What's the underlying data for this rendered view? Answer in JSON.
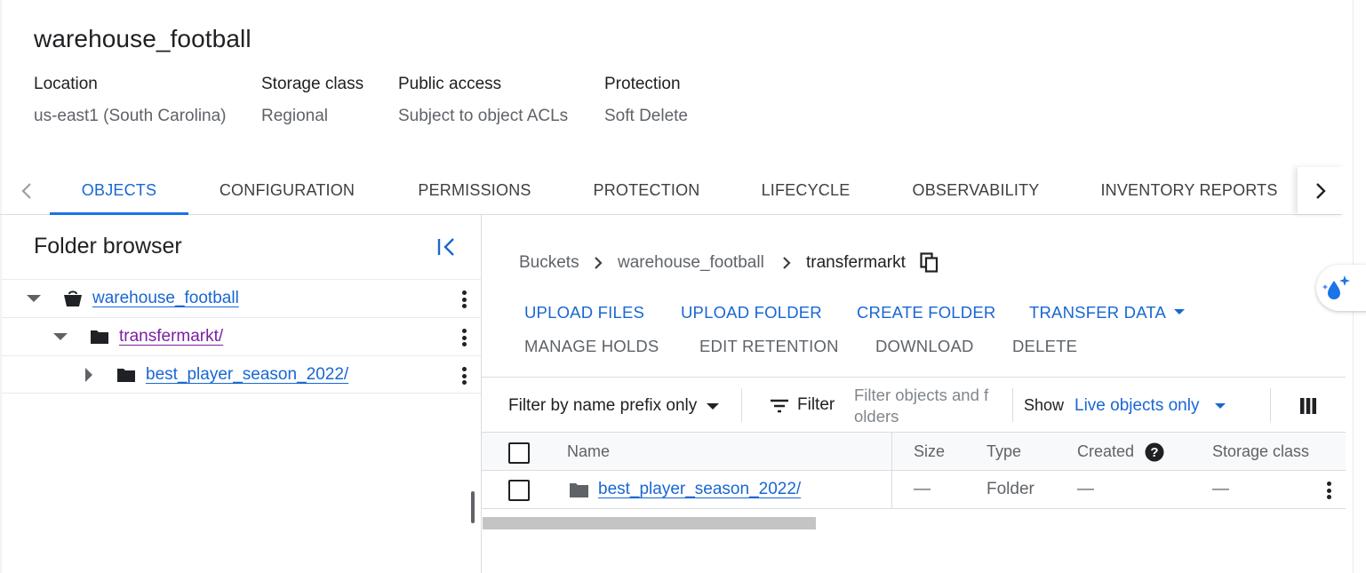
{
  "bucket": {
    "title": "warehouse_football",
    "meta": [
      {
        "label": "Location",
        "value": "us-east1 (South Carolina)"
      },
      {
        "label": "Storage class",
        "value": "Regional"
      },
      {
        "label": "Public access",
        "value": "Subject to object ACLs"
      },
      {
        "label": "Protection",
        "value": "Soft Delete"
      }
    ]
  },
  "tabs": [
    {
      "label": "OBJECTS",
      "active": true
    },
    {
      "label": "CONFIGURATION"
    },
    {
      "label": "PERMISSIONS"
    },
    {
      "label": "PROTECTION"
    },
    {
      "label": "LIFECYCLE"
    },
    {
      "label": "OBSERVABILITY"
    },
    {
      "label": "INVENTORY REPORTS"
    }
  ],
  "folder_browser": {
    "title": "Folder browser",
    "tree": [
      {
        "label": "warehouse_football",
        "icon": "bucket-icon",
        "expanded": true
      },
      {
        "label": "transfermarkt/",
        "icon": "folder-icon",
        "expanded": true,
        "visited": true
      },
      {
        "label": "best_player_season_2022/",
        "icon": "folder-icon",
        "expanded": false
      }
    ]
  },
  "breadcrumb": [
    "Buckets",
    "warehouse_football",
    "transfermarkt"
  ],
  "actions": {
    "primary": [
      "UPLOAD FILES",
      "UPLOAD FOLDER",
      "CREATE FOLDER",
      "TRANSFER DATA"
    ],
    "secondary": [
      "MANAGE HOLDS",
      "EDIT RETENTION",
      "DOWNLOAD",
      "DELETE"
    ]
  },
  "filter": {
    "mode": "Filter by name prefix only",
    "filter_label": "Filter",
    "placeholder_line1": "Filter objects and f",
    "placeholder_line2": "olders",
    "show_label": "Show",
    "show_value": "Live objects only"
  },
  "table": {
    "columns": [
      "Name",
      "Size",
      "Type",
      "Created",
      "Storage class"
    ],
    "rows": [
      {
        "name": "best_player_season_2022/",
        "size": "—",
        "type": "Folder",
        "created": "—",
        "storage_class": "—"
      }
    ]
  },
  "colors": {
    "accent": "#1967d2",
    "visited_link": "#7b1fa2",
    "secondary_text": "#5f6368"
  }
}
